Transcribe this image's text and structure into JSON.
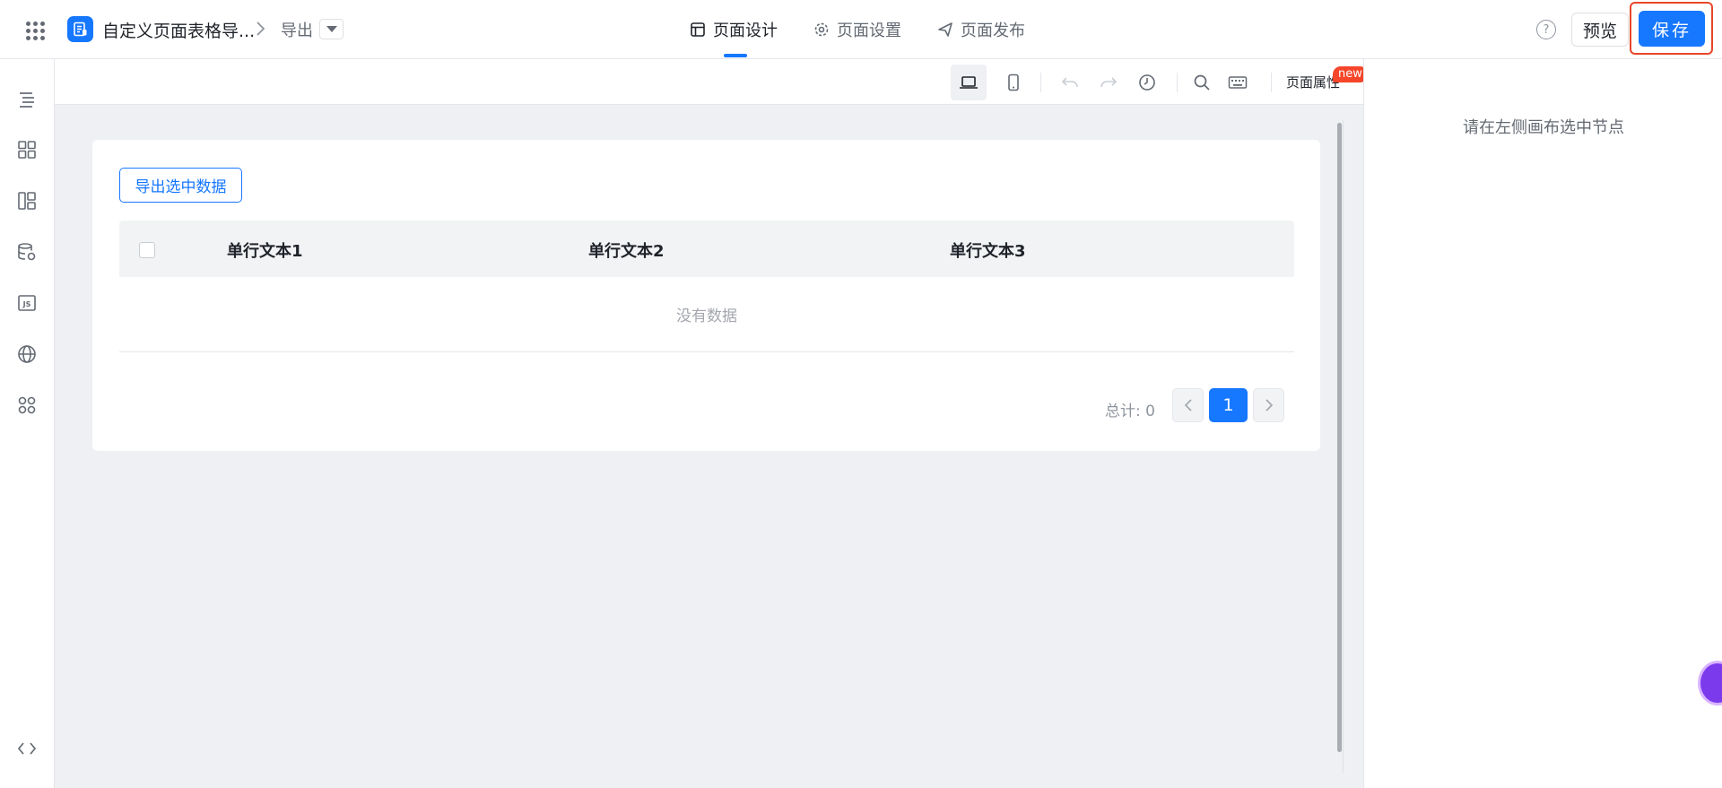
{
  "header": {
    "app_title": "自定义页面表格导...",
    "page_name": "导出",
    "tabs": [
      {
        "label": "页面设计",
        "icon": "layout-icon",
        "active": true
      },
      {
        "label": "页面设置",
        "icon": "gear-icon",
        "active": false
      },
      {
        "label": "页面发布",
        "icon": "send-icon",
        "active": false
      }
    ],
    "help_label": "?",
    "preview_label": "预览",
    "save_label": "保存"
  },
  "sidebar": {
    "icons": [
      "outline-tree-icon",
      "components-grid-icon",
      "layout-template-icon",
      "datasource-settings-icon",
      "js-code-icon",
      "globe-icon",
      "apps-icon",
      "code-brackets-icon"
    ]
  },
  "toolbar": {
    "page_property_label": "页面属性",
    "new_badge": "new"
  },
  "canvas": {
    "export_button_label": "导出选中数据",
    "table": {
      "columns": [
        "单行文本1",
        "单行文本2",
        "单行文本3"
      ],
      "empty_text": "没有数据"
    },
    "pagination": {
      "total_label": "总计: 0",
      "current_page": "1"
    }
  },
  "right_panel": {
    "tip": "请在左侧画布选中节点"
  },
  "colors": {
    "primary": "#1677ff",
    "highlight": "#e8462a",
    "status": "#22c55e",
    "badge": "#f5452a"
  }
}
